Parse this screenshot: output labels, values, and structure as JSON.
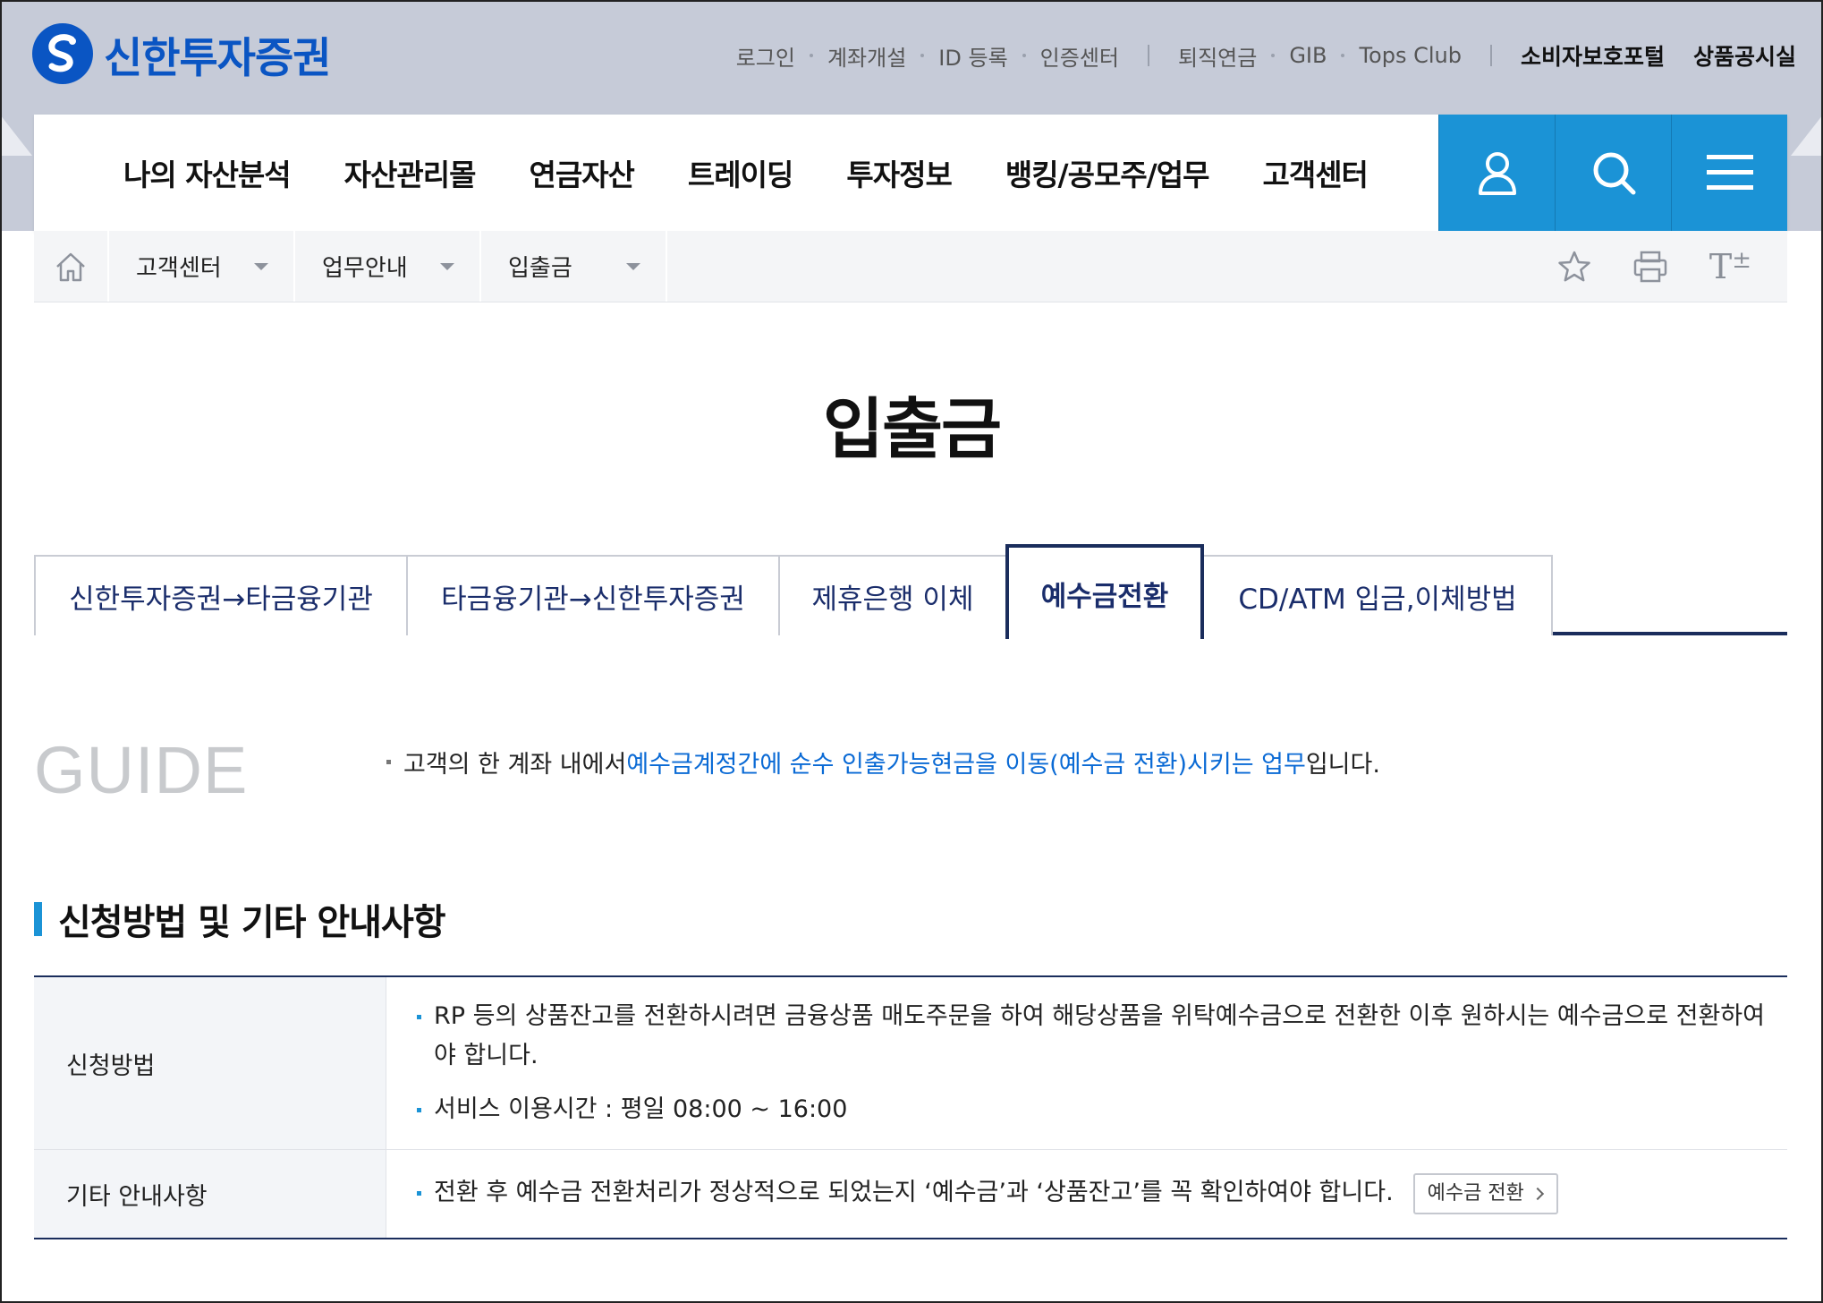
{
  "brand": {
    "name": "신한투자증권",
    "color": "#0a55c3"
  },
  "utility": {
    "links": [
      "로그인",
      "계좌개설",
      "ID 등록",
      "인증센터"
    ],
    "links2": [
      "퇴직연금",
      "GIB",
      "Tops Club"
    ],
    "strong": [
      "소비자보호포털",
      "상품공시실"
    ]
  },
  "gnb": {
    "menu": [
      "나의 자산분석",
      "자산관리몰",
      "연금자산",
      "트레이딩",
      "투자정보",
      "뱅킹/공모주/업무",
      "고객센터"
    ],
    "buttons": {
      "user": "user-icon",
      "search": "search-icon",
      "menu": "hamburger-menu-icon",
      "color": "#1b93d6"
    }
  },
  "breadcrumb": {
    "home_icon": "home-icon",
    "items": [
      "고객센터",
      "업무안내",
      "입출금"
    ],
    "tools": {
      "favorite": "star-icon",
      "print": "printer-icon",
      "font_size": "T",
      "font_size_sign": "±"
    }
  },
  "page": {
    "title": "입출금"
  },
  "tabs": [
    {
      "label": "신한투자증권→타금융기관",
      "active": false
    },
    {
      "label": "타금융기관→신한투자증권",
      "active": false
    },
    {
      "label": "제휴은행 이체",
      "active": false
    },
    {
      "label": "예수금전환",
      "active": true
    },
    {
      "label": "CD/ATM 입금,이체방법",
      "active": false
    }
  ],
  "guide": {
    "word": "GUIDE",
    "text_before": "고객의 한 계좌 내에서 ",
    "text_highlight": "예수금계정간에 순수 인출가능현금을 이동(예수금 전환)시키는 업무",
    "text_after": "입니다."
  },
  "section": {
    "title": "신청방법 및 기타 안내사항"
  },
  "table": {
    "rows": [
      {
        "header": "신청방법",
        "items": [
          "RP 등의 상품잔고를 전환하시려면 금융상품 매도주문을 하여 해당상품을 위탁예수금으로 전환한 이후 원하시는 예수금으로 전환하여야 합니다.",
          "서비스 이용시간 : 평일 08:00 ~ 16:00"
        ]
      },
      {
        "header": "기타 안내사항",
        "items": [
          "전환 후 예수금 전환처리가 정상적으로 되었는지 ‘예수금’과 ‘상품잔고’를 꼭 확인하여야 합니다."
        ],
        "button": "예수금 전환"
      }
    ]
  }
}
